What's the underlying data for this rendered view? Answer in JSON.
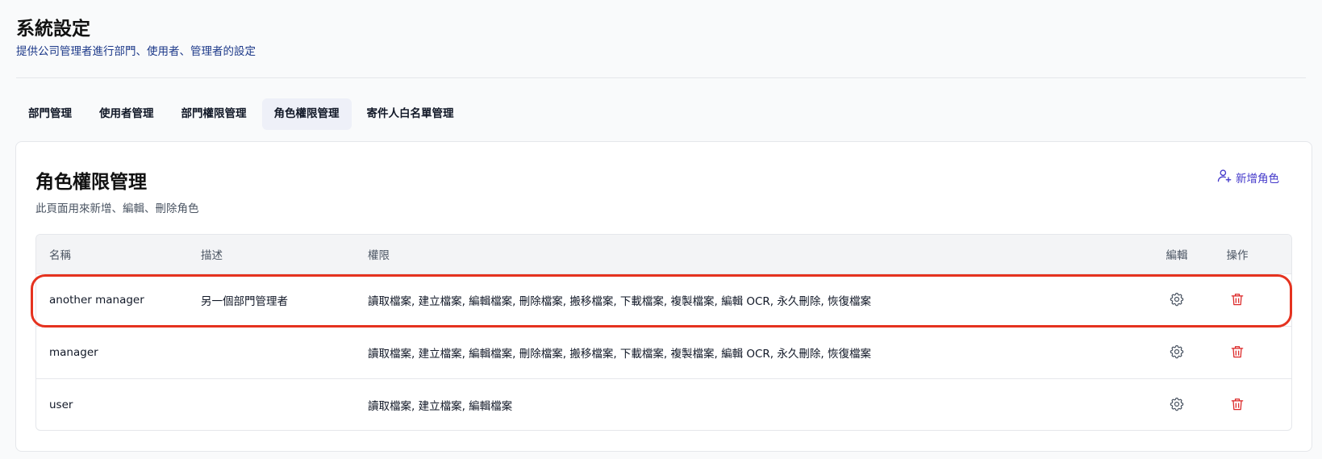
{
  "header": {
    "title": "系統設定",
    "subtitle": "提供公司管理者進行部門、使用者、管理者的設定"
  },
  "tabs": [
    {
      "label": "部門管理",
      "active": false
    },
    {
      "label": "使用者管理",
      "active": false
    },
    {
      "label": "部門權限管理",
      "active": false
    },
    {
      "label": "角色權限管理",
      "active": true
    },
    {
      "label": "寄件人白名單管理",
      "active": false
    }
  ],
  "card": {
    "title": "角色權限管理",
    "description": "此頁面用來新增、編輯、刪除角色",
    "add_button_label": "新增角色",
    "add_button_icon": "user-plus-icon"
  },
  "table": {
    "columns": [
      "名稱",
      "描述",
      "權限",
      "編輯",
      "操作"
    ],
    "rows": [
      {
        "name": "another manager",
        "description": "另一個部門管理者",
        "permissions": "讀取檔案, 建立檔案, 編輯檔案, 刪除檔案, 搬移檔案, 下載檔案, 複製檔案, 編輯 OCR, 永久刪除, 恢復檔案",
        "highlighted": true
      },
      {
        "name": "manager",
        "description": "",
        "permissions": "讀取檔案, 建立檔案, 編輯檔案, 刪除檔案, 搬移檔案, 下載檔案, 複製檔案, 編輯 OCR, 永久刪除, 恢復檔案",
        "highlighted": false
      },
      {
        "name": "user",
        "description": "",
        "permissions": "讀取檔案, 建立檔案, 編輯檔案",
        "highlighted": false
      }
    ],
    "edit_icon": "gear-icon",
    "delete_icon": "trash-icon"
  },
  "colors": {
    "accent": "#4338ca",
    "delete": "#dc2626",
    "highlight_border": "#e5321f",
    "active_tab_bg": "#eef0f8"
  }
}
